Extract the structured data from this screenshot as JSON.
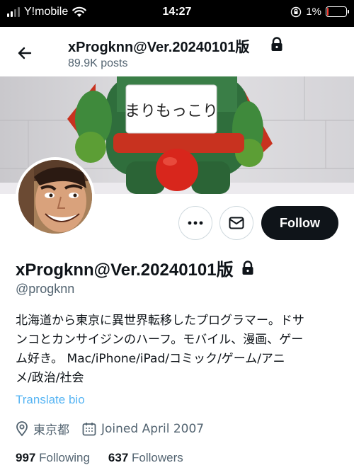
{
  "status_bar": {
    "carrier": "Y!mobile",
    "time": "14:27",
    "battery": "1%"
  },
  "nav": {
    "title": "xProgknn@Ver.20240101版",
    "posts": "89.9K posts"
  },
  "banner": {
    "sign_text": "まりもっこり"
  },
  "actions": {
    "follow_label": "Follow"
  },
  "profile": {
    "display_name": "xProgknn@Ver.20240101版",
    "handle": "@progknn",
    "bio_lines": [
      "北海道から東京に異世界転移したプログラマー。ドサ",
      "ンコとカンサイジンのハーフ。モバイル、漫画、ゲー",
      "ム好き。 Mac/iPhone/iPad/コミック/ゲーム/アニ",
      "メ/政治/社会"
    ],
    "translate_label": "Translate bio",
    "location": "東京都",
    "joined": "Joined April 2007",
    "following_count": "997",
    "following_label": "Following",
    "followers_count": "637",
    "followers_label": "Followers"
  },
  "icons": [
    "signal-icon",
    "wifi-icon",
    "rotation-lock-icon",
    "battery-icon",
    "back-arrow-icon",
    "lock-icon",
    "more-icon",
    "mail-icon",
    "location-icon",
    "calendar-icon"
  ],
  "colors": {
    "link": "#1d9bf0",
    "muted": "#536471",
    "text": "#0f1419",
    "battery_low": "#ff3b30"
  }
}
